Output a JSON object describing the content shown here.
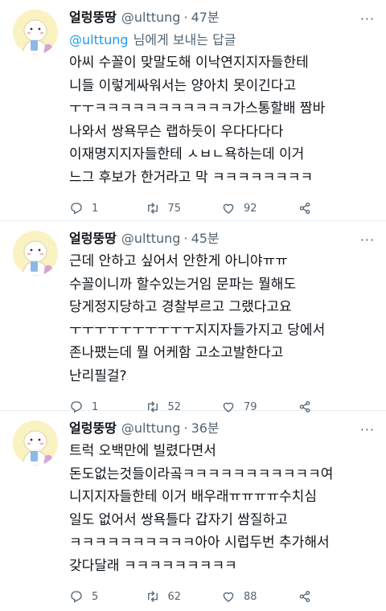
{
  "tweets": [
    {
      "name": "얼렁뚱땅",
      "handle": "@ulttung",
      "dot": "·",
      "time": "47분",
      "more": "···",
      "reply_mention": "@ulttung",
      "reply_suffix": "님에게 보내는 답글",
      "lines": [
        "아씨 수꼴이 맞말도해 이낙연지지자들한테",
        "니들 이렇게싸워서는 양아치 못이긴다고",
        "ㅜㅜㅋㅋㅋㅋㅋㅋㅋㅋㅋㅋㅋ가스통할배 짬바",
        "나와서 쌍욕무슨 랩하듯이 우다다다다",
        "이재명지지자들한테 ㅅㅂㄴ욕하는데 이거",
        "느그 후보가 한거라고 막 ㅋㅋㅋㅋㅋㅋㅋㅋ"
      ],
      "reply_count": "1",
      "retweet_count": "75",
      "like_count": "92"
    },
    {
      "name": "얼렁뚱땅",
      "handle": "@ulttung",
      "dot": "·",
      "time": "45분",
      "more": "···",
      "lines": [
        "근데 안하고 싶어서 안한게 아니야ㅠㅠ",
        "수꼴이니까 할수있는거임 문파는 뭘해도",
        "당게정지당하고 경찰부르고 그랬다고요",
        "ㅜㅜㅜㅜㅜㅜㅜㅜㅜㅜ지지자들가지고 당에서",
        "존나팼는데 뭘 어케함 고소고발한다고",
        "난리필걸?"
      ],
      "reply_count": "1",
      "retweet_count": "52",
      "like_count": "79"
    },
    {
      "name": "얼렁뚱땅",
      "handle": "@ulttung",
      "dot": "·",
      "time": "36분",
      "more": "···",
      "lines": [
        "트럭 오백만에 빌렸다면서",
        "돈도없는것들이라곸ㅋㅋㅋㅋㅋㅋㅋㅋㅋㅋㅋ여",
        "니지지자들한테 이거 배우래ㅠㅠㅠㅠ수치심",
        "일도 없어서 쌍욕틀다 갑자기 쌈질하고",
        "ㅋㅋㅋㅋㅋㅋㅋㅋㅋㅋ아아 시럽두번 추가해서",
        "갖다달래 ㅋㅋㅋㅋㅋㅋㅋㅋㅋ"
      ],
      "reply_count": "5",
      "retweet_count": "62",
      "like_count": "88"
    }
  ],
  "icons": {
    "reply": "reply-icon",
    "retweet": "retweet-icon",
    "like": "like-icon",
    "share": "share-icon",
    "more": "more-icon"
  },
  "colors": {
    "text": "#0f1419",
    "secondary": "#536471",
    "link": "#1d9bf0",
    "avatar_bg": "#fbf2c2",
    "divider": "#e6ecf0"
  }
}
